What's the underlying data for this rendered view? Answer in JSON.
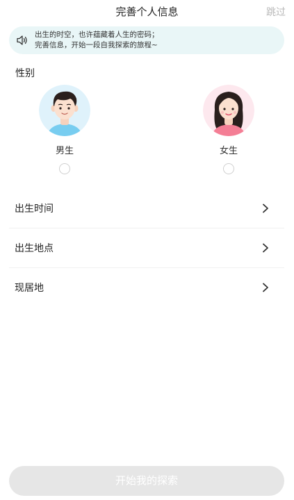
{
  "header": {
    "title": "完善个人信息",
    "skip_label": "跳过"
  },
  "notice": {
    "icon": "speaker-icon",
    "line1": "出生的时空，也许蕴藏着人生的密码；",
    "line2": "完善信息，开始一段自我探索的旅程~",
    "background_color": "#e9f6f7"
  },
  "gender": {
    "label": "性别",
    "options": [
      {
        "label": "男生",
        "avatar": "male-avatar",
        "selected": false
      },
      {
        "label": "女生",
        "avatar": "female-avatar",
        "selected": false
      }
    ]
  },
  "fields": [
    {
      "label": "出生时间",
      "icon": "chevron-right-icon"
    },
    {
      "label": "出生地点",
      "icon": "chevron-right-icon"
    },
    {
      "label": "现居地",
      "icon": "chevron-right-icon"
    }
  ],
  "start_button": {
    "label": "开始我的探索",
    "color": "#e6e6e6"
  }
}
